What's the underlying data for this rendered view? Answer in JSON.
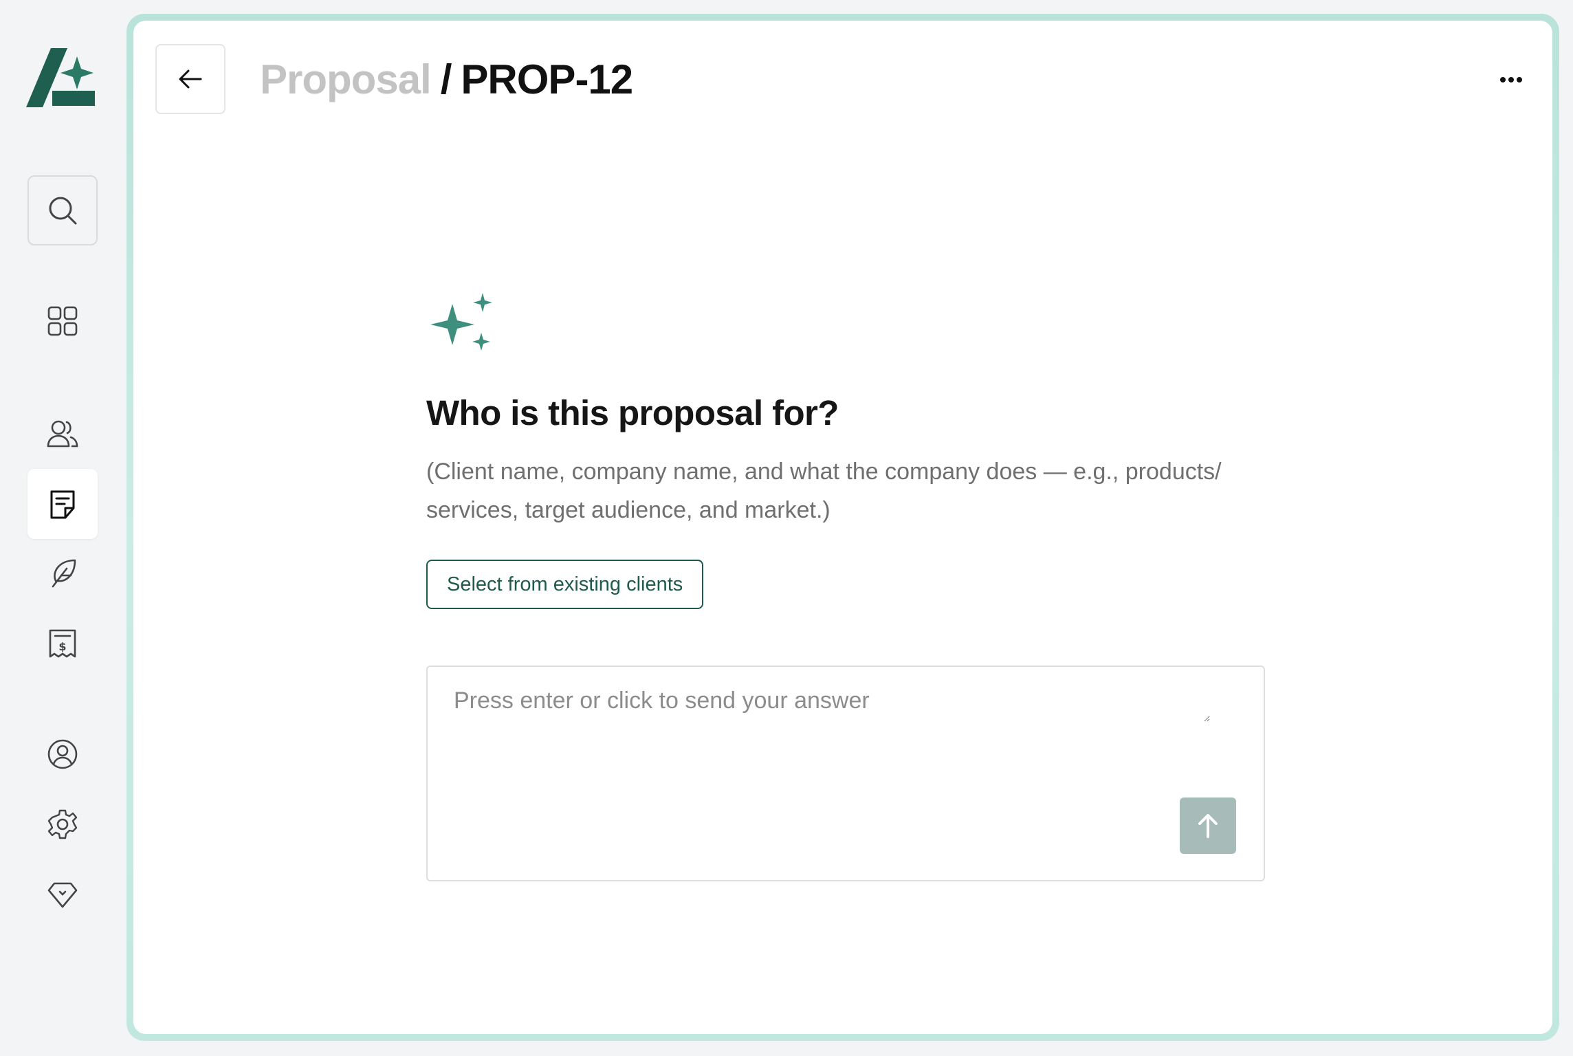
{
  "sidebar": {
    "logo": "ai-logo",
    "items": [
      {
        "icon": "search-icon"
      },
      {
        "icon": "grid-icon"
      },
      {
        "icon": "users-icon"
      },
      {
        "icon": "proposal-document-icon",
        "active": true
      },
      {
        "icon": "feather-icon"
      },
      {
        "icon": "invoice-icon"
      },
      {
        "icon": "account-circle-icon"
      },
      {
        "icon": "gear-icon"
      },
      {
        "icon": "diamond-icon"
      }
    ]
  },
  "header": {
    "breadcrumb_parent": "Proposal",
    "breadcrumb_separator": "/",
    "breadcrumb_current": "PROP-12",
    "more_icon": "more-horizontal-icon",
    "back_icon": "arrow-left-icon"
  },
  "main": {
    "question": "Who is this proposal for?",
    "hint": "(Client name, company name, and what the company does — e.g., products/ services, target audience, and market.)",
    "select_button_label": "Select from existing clients",
    "answer_placeholder": "Press enter or click to send your answer",
    "send_icon": "arrow-up-icon"
  },
  "colors": {
    "accent": "#1e5b4d",
    "sparkle": "#3f8f7f",
    "frame": "#bfe6dd",
    "send_button": "#a7bcb8"
  }
}
